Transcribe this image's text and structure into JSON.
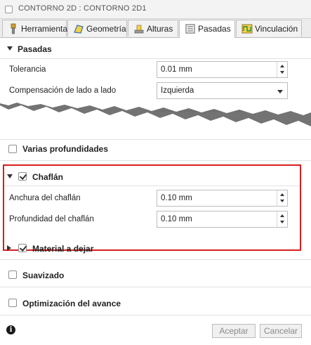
{
  "window": {
    "title": "CONTORNO 2D : CONTORNO 2D1"
  },
  "tabs": [
    {
      "label": "Herramienta",
      "icon": "tool-icon",
      "active": false
    },
    {
      "label": "Geometría",
      "icon": "geometry-icon",
      "active": false
    },
    {
      "label": "Alturas",
      "icon": "heights-icon",
      "active": false
    },
    {
      "label": "Pasadas",
      "icon": "passes-icon",
      "active": true
    },
    {
      "label": "Vinculación",
      "icon": "linking-icon",
      "active": false
    }
  ],
  "pasadas": {
    "title": "Pasadas",
    "tolerancia_label": "Tolerancia",
    "tolerancia_value": "0.01 mm",
    "compensacion_label": "Compensación de lado a lado",
    "compensacion_value": "Izquierda"
  },
  "varias": {
    "label": "Varias profundidades",
    "checked": false
  },
  "chaflan": {
    "title": "Chaflán",
    "checked": true,
    "anchura_label": "Anchura del chaflán",
    "anchura_value": "0.10 mm",
    "profundidad_label": "Profundidad del chaflán",
    "profundidad_value": "0.10 mm",
    "highlight_color": "#d81e1e"
  },
  "material": {
    "label": "Material a dejar",
    "checked": true
  },
  "suavizado": {
    "label": "Suavizado",
    "checked": false
  },
  "optimizacion": {
    "label": "Optimización del avance",
    "checked": false
  },
  "footer": {
    "info_glyph": "i",
    "accept_label": "Aceptar",
    "cancel_label": "Cancelar"
  }
}
